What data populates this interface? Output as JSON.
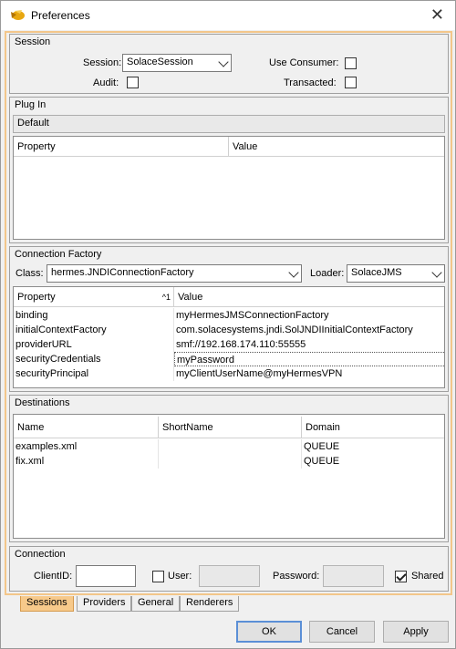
{
  "window": {
    "title": "Preferences",
    "close_glyph": "✕",
    "icon": "app-icon"
  },
  "session": {
    "group_title": "Session",
    "session_label": "Session:",
    "session_value": "SolaceSession",
    "use_consumer_label": "Use Consumer:",
    "use_consumer_checked": false,
    "audit_label": "Audit:",
    "audit_checked": false,
    "transacted_label": "Transacted:",
    "transacted_checked": false
  },
  "plugin": {
    "group_title": "Plug In",
    "selected": "Default",
    "columns": [
      "Property",
      "Value"
    ],
    "rows": []
  },
  "connection_factory": {
    "group_title": "Connection Factory",
    "class_label": "Class:",
    "class_value": "hermes.JNDIConnectionFactory",
    "loader_label": "Loader:",
    "loader_value": "SolaceJMS",
    "columns": [
      "Property",
      "Value"
    ],
    "sort_indicator": "^1",
    "rows": [
      {
        "property": "binding",
        "value": "myHermesJMSConnectionFactory"
      },
      {
        "property": "initialContextFactory",
        "value": "com.solacesystems.jndi.SolJNDIInitialContextFactory"
      },
      {
        "property": "providerURL",
        "value": "smf://192.168.174.110:55555"
      },
      {
        "property": "securityCredentials",
        "value": "myPassword"
      },
      {
        "property": "securityPrincipal",
        "value": "myClientUserName@myHermesVPN"
      }
    ]
  },
  "destinations": {
    "group_title": "Destinations",
    "columns": [
      "Name",
      "ShortName",
      "Domain"
    ],
    "rows": [
      {
        "name": "examples.xml",
        "short_name": "",
        "domain": "QUEUE"
      },
      {
        "name": "fix.xml",
        "short_name": "",
        "domain": "QUEUE"
      }
    ]
  },
  "connection": {
    "group_title": "Connection",
    "client_id_label": "ClientID:",
    "client_id_value": "",
    "user_label": "User:",
    "user_checked": false,
    "user_value": "",
    "password_label": "Password:",
    "password_value": "",
    "shared_label": "Shared",
    "shared_checked": true
  },
  "tabs": [
    {
      "label": "Sessions",
      "active": true
    },
    {
      "label": "Providers",
      "active": false
    },
    {
      "label": "General",
      "active": false
    },
    {
      "label": "Renderers",
      "active": false
    }
  ],
  "buttons": {
    "ok": "OK",
    "cancel": "Cancel",
    "apply": "Apply"
  },
  "colors": {
    "active_tab": "#f7c98a",
    "panel_border": "#f3c68a",
    "default_button_border": "#5b8fd6"
  }
}
